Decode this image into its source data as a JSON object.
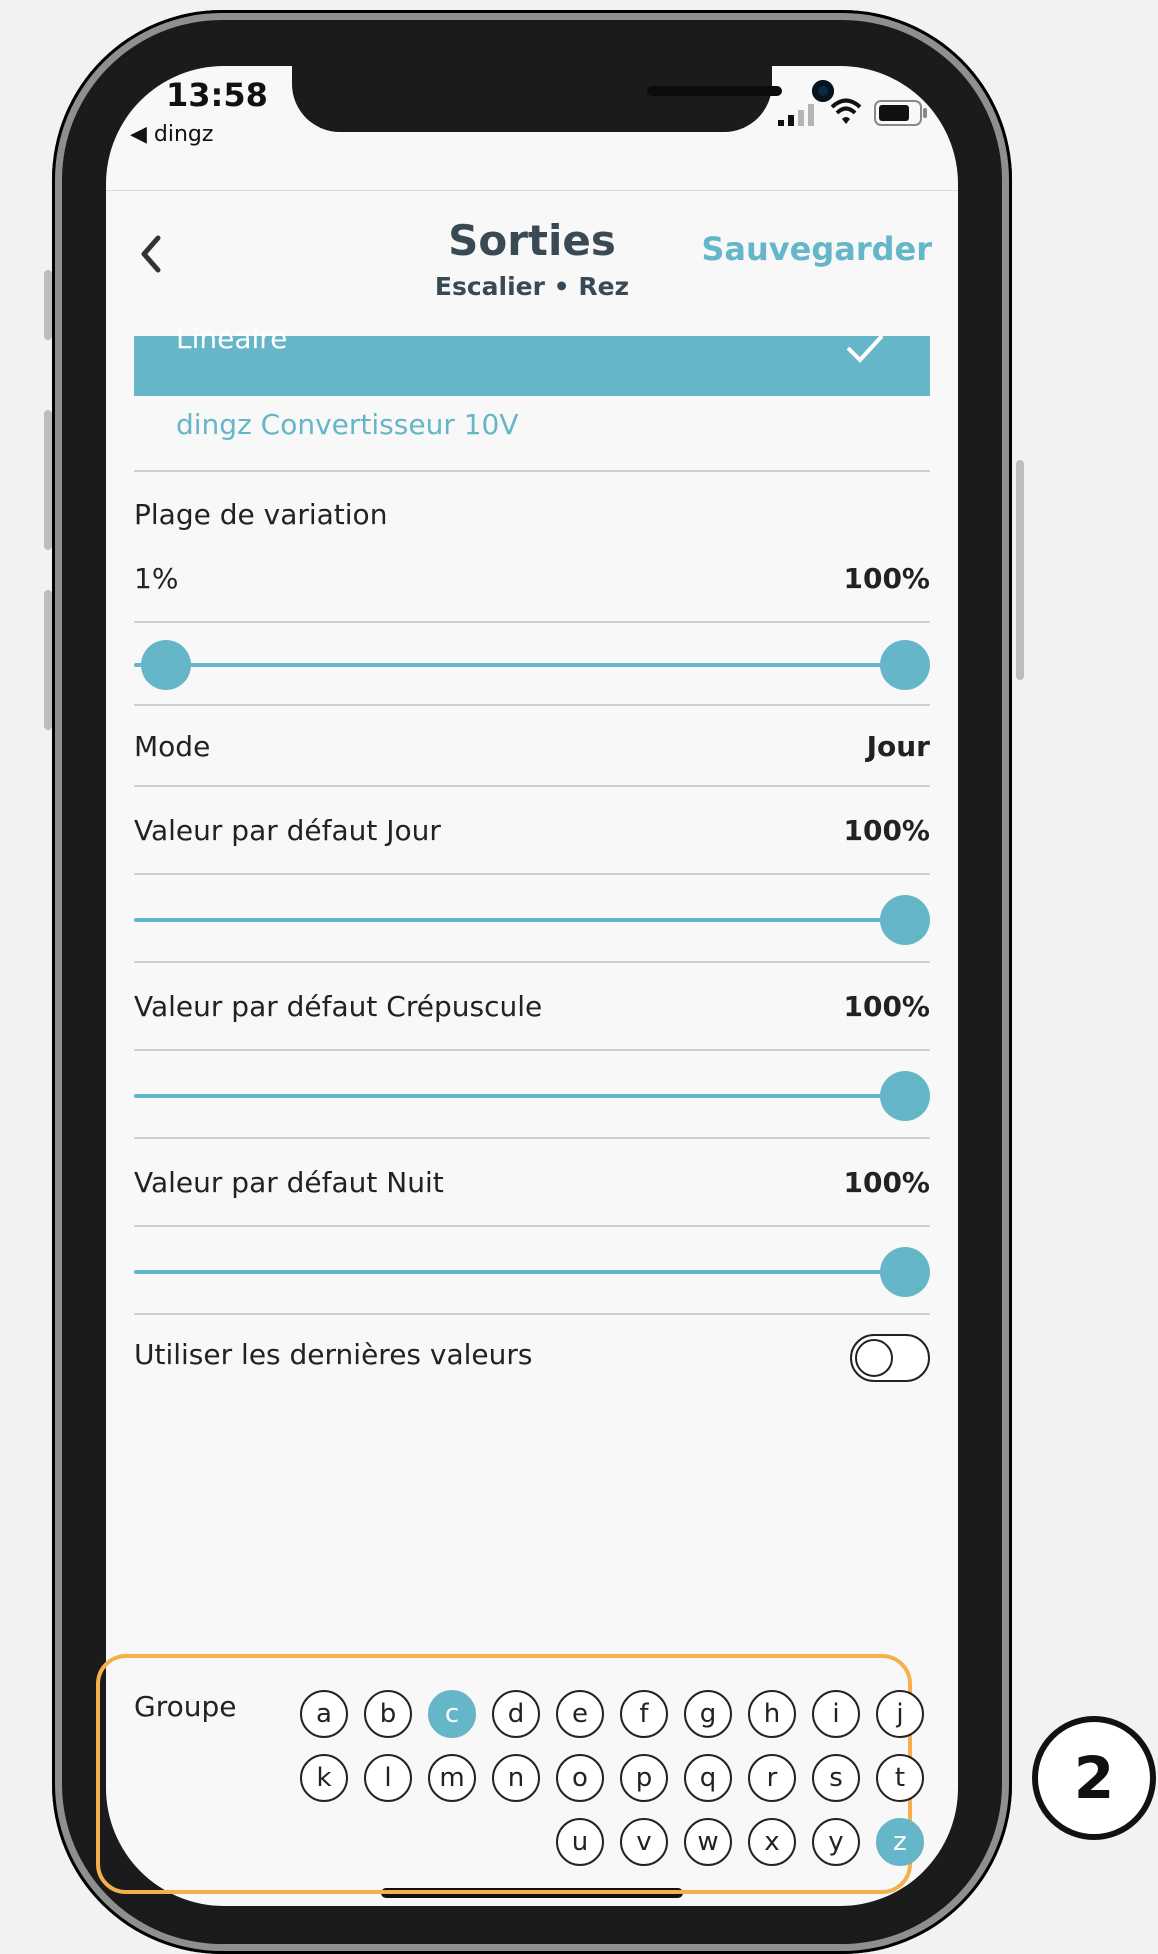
{
  "status_bar": {
    "time": "13:58",
    "back_app": "◀ dingz"
  },
  "header": {
    "title": "Sorties",
    "subtitle": "Escalier • Rez",
    "save_label": "Sauvegarder"
  },
  "curve_options": {
    "selected": "Linéaire",
    "other": "dingz Convertisseur 10V"
  },
  "range": {
    "label": "Plage de variation",
    "min_label": "1%",
    "max_label": "100%",
    "min_value": 1,
    "max_value": 100
  },
  "mode": {
    "label": "Mode",
    "value": "Jour"
  },
  "defaults": [
    {
      "label": "Valeur par défaut Jour",
      "value_label": "100%",
      "value": 100
    },
    {
      "label": "Valeur par défaut Crépuscule",
      "value_label": "100%",
      "value": 100
    },
    {
      "label": "Valeur par défaut Nuit",
      "value_label": "100%",
      "value": 100
    }
  ],
  "last_values": {
    "label": "Utiliser les dernières valeurs",
    "enabled": false
  },
  "group": {
    "label": "Groupe",
    "letters": [
      "a",
      "b",
      "c",
      "d",
      "e",
      "f",
      "g",
      "h",
      "i",
      "j",
      "k",
      "l",
      "m",
      "n",
      "o",
      "p",
      "q",
      "r",
      "s",
      "t",
      "u",
      "v",
      "w",
      "x",
      "y",
      "z"
    ],
    "active": [
      "c",
      "z"
    ]
  },
  "callout": {
    "number": "2"
  },
  "colors": {
    "accent": "#66b6c9",
    "highlight": "#f5b04d"
  }
}
